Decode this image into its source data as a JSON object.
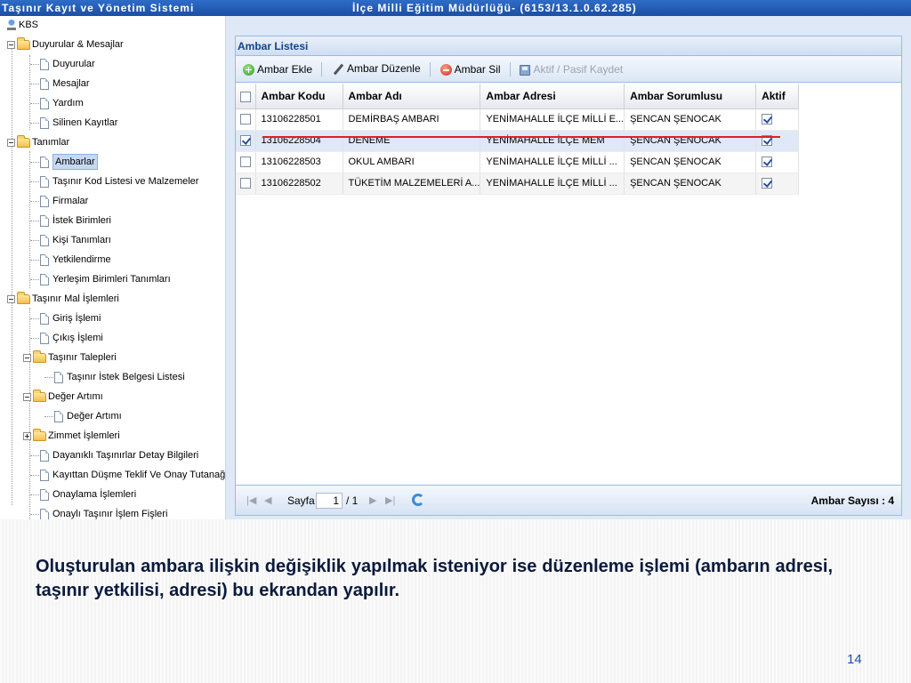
{
  "titlebar": {
    "app_title": "Taşınır Kayıt ve Yönetim Sistemi",
    "org_title": "İlçe Milli Eğitim Müdürlüğü- (6153/13.1.0.62.285)"
  },
  "tree": {
    "root": "KBS",
    "items": [
      {
        "label": "Duyurular & Mesajlar",
        "level": 1,
        "type": "folder",
        "toggle": "minus"
      },
      {
        "label": "Duyurular",
        "level": 2,
        "type": "page"
      },
      {
        "label": "Mesajlar",
        "level": 2,
        "type": "page"
      },
      {
        "label": "Yardım",
        "level": 2,
        "type": "page"
      },
      {
        "label": "Silinen Kayıtlar",
        "level": 2,
        "type": "page"
      },
      {
        "label": "Tanımlar",
        "level": 1,
        "type": "folder",
        "toggle": "minus"
      },
      {
        "label": "Ambarlar",
        "level": 2,
        "type": "page",
        "selected": true
      },
      {
        "label": "Taşınır Kod Listesi ve Malzemeler",
        "level": 2,
        "type": "page"
      },
      {
        "label": "Firmalar",
        "level": 2,
        "type": "page"
      },
      {
        "label": "İstek Birimleri",
        "level": 2,
        "type": "page"
      },
      {
        "label": "Kişi Tanımları",
        "level": 2,
        "type": "page"
      },
      {
        "label": "Yetkilendirme",
        "level": 2,
        "type": "page"
      },
      {
        "label": "Yerleşim Birimleri Tanımları",
        "level": 2,
        "type": "page"
      },
      {
        "label": "Taşınır Mal İşlemleri",
        "level": 1,
        "type": "folder",
        "toggle": "minus"
      },
      {
        "label": "Giriş İşlemi",
        "level": 2,
        "type": "page"
      },
      {
        "label": "Çıkış İşlemi",
        "level": 2,
        "type": "page"
      },
      {
        "label": "Taşınır Talepleri",
        "level": 2,
        "type": "folder",
        "toggle": "minus"
      },
      {
        "label": "Taşınır İstek Belgesi Listesi",
        "level": 3,
        "type": "page"
      },
      {
        "label": "Değer Artımı",
        "level": 2,
        "type": "folder",
        "toggle": "minus"
      },
      {
        "label": "Değer Artımı",
        "level": 3,
        "type": "page"
      },
      {
        "label": "Zimmet İşlemleri",
        "level": 2,
        "type": "folder",
        "toggle": "plus"
      },
      {
        "label": "Dayanıklı Taşınırlar Detay Bilgileri",
        "level": 2,
        "type": "page"
      },
      {
        "label": "Kayıttan Düşme Teklif Ve Onay Tutanağı",
        "level": 2,
        "type": "page"
      },
      {
        "label": "Onaylama İşlemleri",
        "level": 2,
        "type": "page"
      },
      {
        "label": "Onaylı Taşınır İşlem Fişleri",
        "level": 2,
        "type": "page"
      }
    ]
  },
  "panel": {
    "title": "Ambar Listesi",
    "toolbar": {
      "add": "Ambar Ekle",
      "edit": "Ambar Düzenle",
      "delete": "Ambar Sil",
      "toggle_active": "Aktif / Pasif Kaydet"
    },
    "columns": [
      "Ambar Kodu",
      "Ambar Adı",
      "Ambar Adresi",
      "Ambar Sorumlusu",
      "Aktif"
    ],
    "rows": [
      {
        "checked": false,
        "code": "13106228501",
        "name": "DEMİRBAŞ AMBARI",
        "address": "YENİMAHALLE İLÇE MİLLİ E...",
        "owner": "ŞENCAN ŞENOCAK",
        "active": true
      },
      {
        "checked": true,
        "code": "13106228504",
        "name": "DENEME",
        "address": "YENİMAHALLE İLÇE MEM",
        "owner": "ŞENCAN ŞENOCAK",
        "active": true
      },
      {
        "checked": false,
        "code": "13106228503",
        "name": "OKUL AMBARI",
        "address": "YENİMAHALLE İLÇE MİLLİ ...",
        "owner": "ŞENCAN ŞENOCAK",
        "active": true
      },
      {
        "checked": false,
        "code": "13106228502",
        "name": "TÜKETİM MALZEMELERİ A...",
        "address": "YENİMAHALLE İLÇE MİLLİ ...",
        "owner": "ŞENCAN ŞENOCAK",
        "active": true
      }
    ],
    "paging": {
      "page_label": "Sayfa",
      "current_page": "1",
      "total_pages": "/ 1",
      "count_label": "Ambar Sayısı : 4"
    }
  },
  "slide": {
    "caption": "Oluşturulan ambara ilişkin değişiklik yapılmak isteniyor ise düzenleme işlemi (ambarın adresi, taşınır yetkilisi, adresi) bu ekrandan yapılır.",
    "page_number": "14"
  },
  "colors": {
    "titlebar": "#1b4fa3",
    "panel_header_text": "#15428b",
    "highlight_line": "#dd2222",
    "slide_number": "#1f4fa8"
  }
}
